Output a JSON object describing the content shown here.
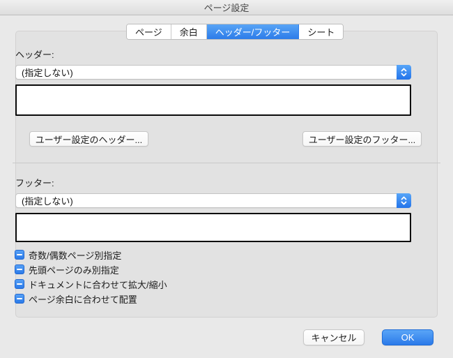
{
  "window": {
    "title": "ページ設定"
  },
  "tabs": [
    {
      "label": "ページ",
      "selected": false
    },
    {
      "label": "余白",
      "selected": false
    },
    {
      "label": "ヘッダー/フッター",
      "selected": true
    },
    {
      "label": "シート",
      "selected": false
    }
  ],
  "header_section": {
    "label": "ヘッダー:",
    "dropdown_value": "(指定しない)",
    "custom_button_label": "ユーザー設定のヘッダー..."
  },
  "footer_section": {
    "label": "フッター:",
    "dropdown_value": "(指定しない)",
    "custom_button_label": "ユーザー設定のフッター..."
  },
  "checkboxes": [
    {
      "label": "奇数/偶数ページ別指定",
      "state": "mixed"
    },
    {
      "label": "先頭ページのみ別指定",
      "state": "mixed"
    },
    {
      "label": "ドキュメントに合わせて拡大/縮小",
      "state": "mixed"
    },
    {
      "label": "ページ余白に合わせて配置",
      "state": "mixed"
    }
  ],
  "actions": {
    "cancel_label": "キャンセル",
    "ok_label": "OK"
  },
  "colors": {
    "accent_blue": "#2d7ce9",
    "dialog_background": "#e9e9e9",
    "groupbox_background": "#e2e2e2",
    "preview_border": "#0a0a0a"
  }
}
